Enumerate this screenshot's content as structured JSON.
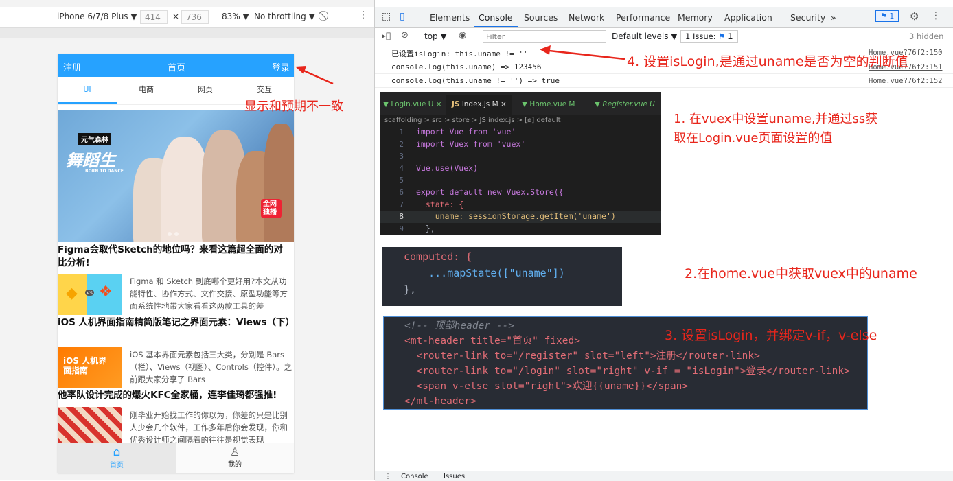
{
  "device_toolbar": {
    "device": "iPhone 6/7/8 Plus ▼",
    "width": "414",
    "height": "736",
    "x": "×",
    "zoom": "83% ▼",
    "throttle": "No throttling ▼"
  },
  "phone": {
    "header": {
      "left": "注册",
      "title": "首页",
      "right": "登录"
    },
    "tabs": [
      "UI",
      "电商",
      "网页",
      "交互"
    ],
    "banner": {
      "badge": "元气森林",
      "title": "舞蹈生",
      "sub": "BORN TO DANCE",
      "stamp": "全网独播"
    },
    "articles": [
      {
        "title": "Figma会取代Sketch的地位吗？来看这篇超全面的对比分析!",
        "desc": "Figma 和 Sketch 到底哪个更好用?本文从功能特性、协作方式、文件交接、原型功能等方面系统性地带大家看看这两款工具的差"
      },
      {
        "title": "iOS 人机界面指南精简版笔记之界面元素：Views（下）",
        "desc": "iOS 基本界面元素包括三大类，分别是 Bars（栏）、Views（视图）、Controls（控件）。之前跟大家分享了 Bars",
        "thumb": "iOS 人机界面指南"
      },
      {
        "title": "他率队设计完成的爆火KFC全家桶，连李佳琦都强推!",
        "desc": "刚毕业开始找工作的你以为，你差的只是比别人少会几个软件，工作多年后你会发现，你和优秀设计师之间隔着的往往是视觉表现"
      }
    ],
    "tabbar": [
      "首页",
      "我的"
    ]
  },
  "devtools": {
    "tabs": [
      "Elements",
      "Console",
      "Sources",
      "Network",
      "Performance",
      "Memory",
      "Application",
      "Security",
      "»"
    ],
    "issues_badge": "1",
    "sub": {
      "context": "top ▼",
      "filter_placeholder": "Filter",
      "levels": "Default levels ▼",
      "issue": "1 Issue:",
      "issue_count": "1",
      "hidden": "3 hidden"
    },
    "console": [
      {
        "text": "已设置isLogin: this.uname != ''",
        "ref": "Home.vue?76f2:150"
      },
      {
        "text": "console.log(this.uname) => 123456",
        "ref": "Home.vue?76f2:151"
      },
      {
        "text": "console.log(this.uname != '') => true",
        "ref": "Home.vue?76f2:152"
      }
    ],
    "drawer": [
      "Console",
      "Issues"
    ]
  },
  "editor": {
    "tabs": [
      "Login.vue U",
      "index.js M",
      "Home.vue M",
      "Register.vue U"
    ],
    "breadcrumb": "scaffolding > src > store > JS index.js > [ø] default",
    "lines": [
      {
        "n": "1",
        "code": "import Vue from 'vue'"
      },
      {
        "n": "2",
        "code": "import Vuex from 'vuex'"
      },
      {
        "n": "3",
        "code": ""
      },
      {
        "n": "4",
        "code": "Vue.use(Vuex)"
      },
      {
        "n": "5",
        "code": ""
      },
      {
        "n": "6",
        "code": "export default new Vuex.Store({"
      },
      {
        "n": "7",
        "code": "  state: {"
      },
      {
        "n": "8",
        "code": "    uname: sessionStorage.getItem('uname')"
      },
      {
        "n": "9",
        "code": "  },"
      }
    ]
  },
  "computed_snippet": [
    "computed: {",
    "    ...mapState([\"uname\"])",
    "},"
  ],
  "template_snippet": [
    "<!-- 顶部header -->",
    "<mt-header title=\"首页\" fixed>",
    "  <router-link to=\"/register\" slot=\"left\">注册</router-link>",
    "  <router-link to=\"/login\" slot=\"right\" v-if = \"isLogin\">登录</router-link>",
    "  <span v-else slot=\"right\">欢迎{{uname}}</span>",
    "</mt-header>"
  ],
  "annotations": {
    "a0": "显示和预期不一致",
    "a1": "1. 在vuex中设置uname,并通过ss获取在Login.vue页面设置的值",
    "a1a": "1. 在vuex中设置uname,并通过ss获",
    "a1b": "取在Login.vue页面设置的值",
    "a2": "2.在home.vue中获取vuex中的uname",
    "a3": "3. 设置isLogin，并绑定v-if，v-else",
    "a4": "4. 设置isLogin,是通过uname是否为空的判断值"
  }
}
